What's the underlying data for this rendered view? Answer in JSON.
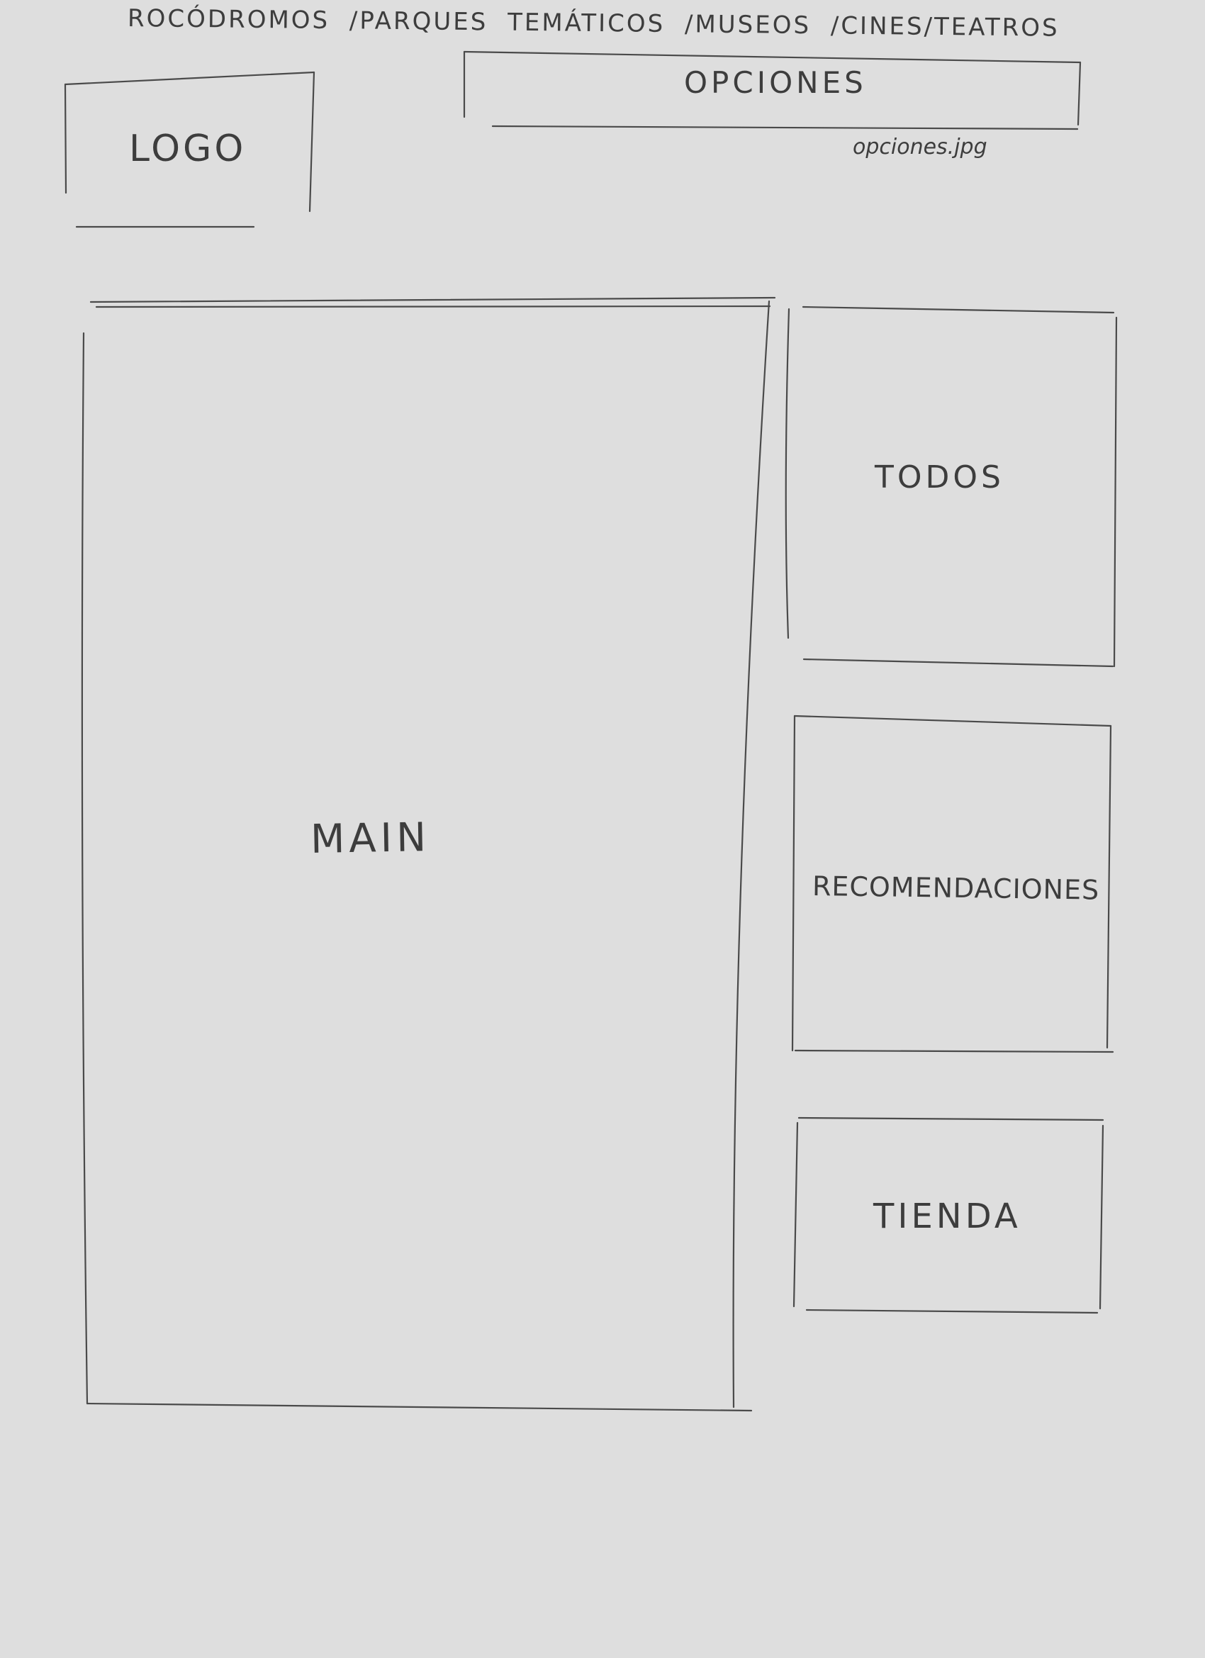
{
  "sketch": {
    "nav_title": "ROCÓDROMOS /PARQUES TEMÁTICOS /MUSEOS /CINES/TEATROS",
    "logo": "LOGO",
    "opciones": "OPCIONES",
    "opciones_file": "opciones.jpg",
    "main": "MAIN",
    "todos": "TODOS",
    "recomendaciones": "RECOMENDACIONES",
    "tienda": "TIENDA"
  },
  "colors": {
    "paper": "#dedede",
    "pencil": "#4a4a4a"
  }
}
